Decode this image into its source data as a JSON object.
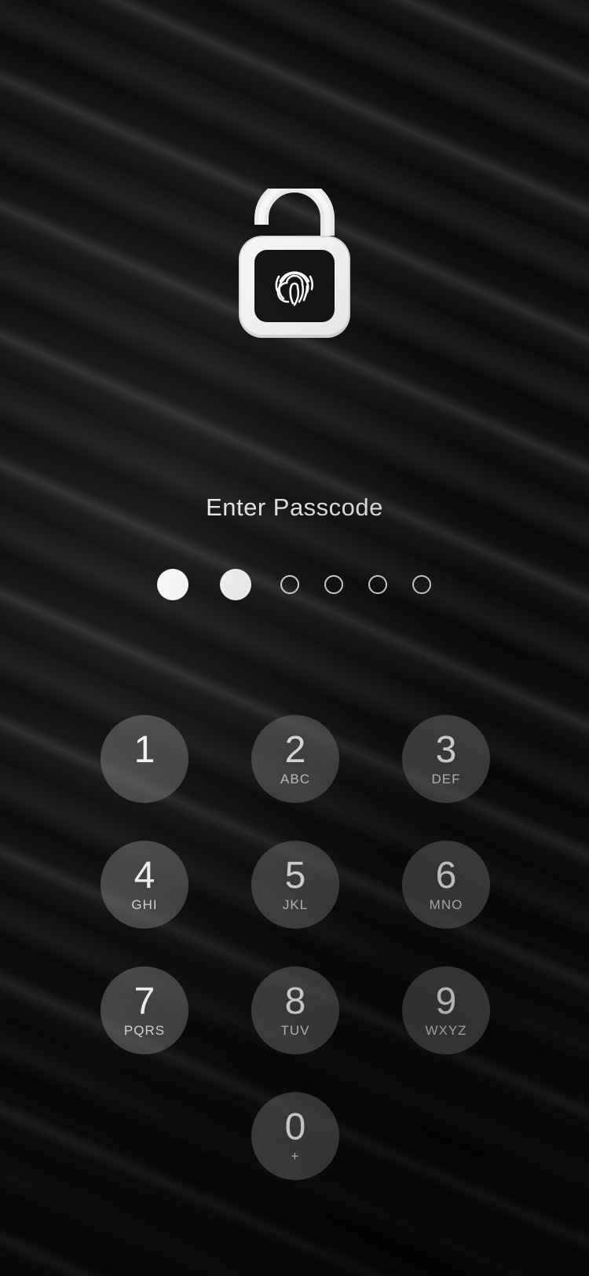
{
  "lock": {
    "icon": "fingerprint-padlock-icon",
    "state": "unlocked"
  },
  "prompt": {
    "title": "Enter Passcode"
  },
  "passcode": {
    "length": 6,
    "entered": 2
  },
  "keypad": {
    "keys": [
      {
        "digit": "1",
        "letters": ""
      },
      {
        "digit": "2",
        "letters": "ABC"
      },
      {
        "digit": "3",
        "letters": "DEF"
      },
      {
        "digit": "4",
        "letters": "GHI"
      },
      {
        "digit": "5",
        "letters": "JKL"
      },
      {
        "digit": "6",
        "letters": "MNO"
      },
      {
        "digit": "7",
        "letters": "PQRS"
      },
      {
        "digit": "8",
        "letters": "TUV"
      },
      {
        "digit": "9",
        "letters": "WXYZ"
      },
      {
        "digit": "0",
        "letters": "+"
      }
    ]
  },
  "colors": {
    "key_fill": "#787878",
    "dot": "#ffffff",
    "background": "#0d0d0e"
  }
}
